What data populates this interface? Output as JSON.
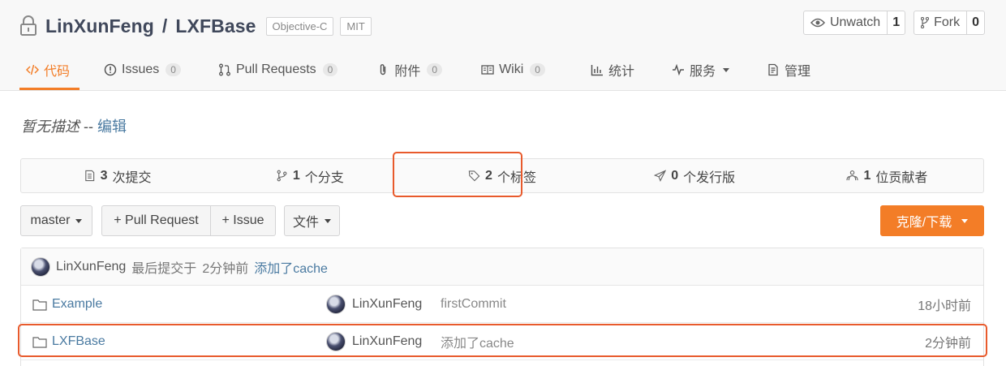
{
  "repo": {
    "owner": "LinXunFeng",
    "separator": "/",
    "name": "LXFBase",
    "language": "Objective-C",
    "license": "MIT"
  },
  "actions": {
    "watch_label": "Unwatch",
    "watch_count": "1",
    "fork_label": "Fork",
    "fork_count": "0"
  },
  "tabs": [
    {
      "label": "代码",
      "icon": "code-icon",
      "count": null,
      "active": true
    },
    {
      "label": "Issues",
      "icon": "issue-icon",
      "count": "0"
    },
    {
      "label": "Pull Requests",
      "icon": "pull-request-icon",
      "count": "0"
    },
    {
      "label": "附件",
      "icon": "paperclip-icon",
      "count": "0"
    },
    {
      "label": "Wiki",
      "icon": "book-icon",
      "count": "0"
    },
    {
      "label": "统计",
      "icon": "graph-icon",
      "count": null
    },
    {
      "label": "服务",
      "icon": "pulse-icon",
      "count": null,
      "dropdown": true
    },
    {
      "label": "管理",
      "icon": "settings-doc-icon",
      "count": null
    }
  ],
  "description": {
    "text": "暂无描述",
    "separator": "--",
    "edit_link": "编辑"
  },
  "stats": [
    {
      "num": "3",
      "label": "次提交",
      "icon": "commits-icon"
    },
    {
      "num": "1",
      "label": "个分支",
      "icon": "branch-icon"
    },
    {
      "num": "2",
      "label": "个标签",
      "icon": "tag-icon"
    },
    {
      "num": "0",
      "label": "个发行版",
      "icon": "release-icon"
    },
    {
      "num": "1",
      "label": "位贡献者",
      "icon": "contributors-icon"
    }
  ],
  "toolbar": {
    "branch": "master",
    "pull_request": "+ Pull Request",
    "issue": "+ Issue",
    "files": "文件",
    "clone": "克隆/下载"
  },
  "latest_commit": {
    "author": "LinXunFeng",
    "label": "最后提交于",
    "time": "2分钟前",
    "message": "添加了cache"
  },
  "files": [
    {
      "name": "Example",
      "author": "LinXunFeng",
      "message": "firstCommit",
      "time": "18小时前"
    },
    {
      "name": "LXFBase",
      "author": "LinXunFeng",
      "message": "添加了cache",
      "time": "2分钟前"
    }
  ],
  "colors": {
    "accent": "#f37d27",
    "highlight": "#e85a2c",
    "link": "#4a7aa1"
  }
}
